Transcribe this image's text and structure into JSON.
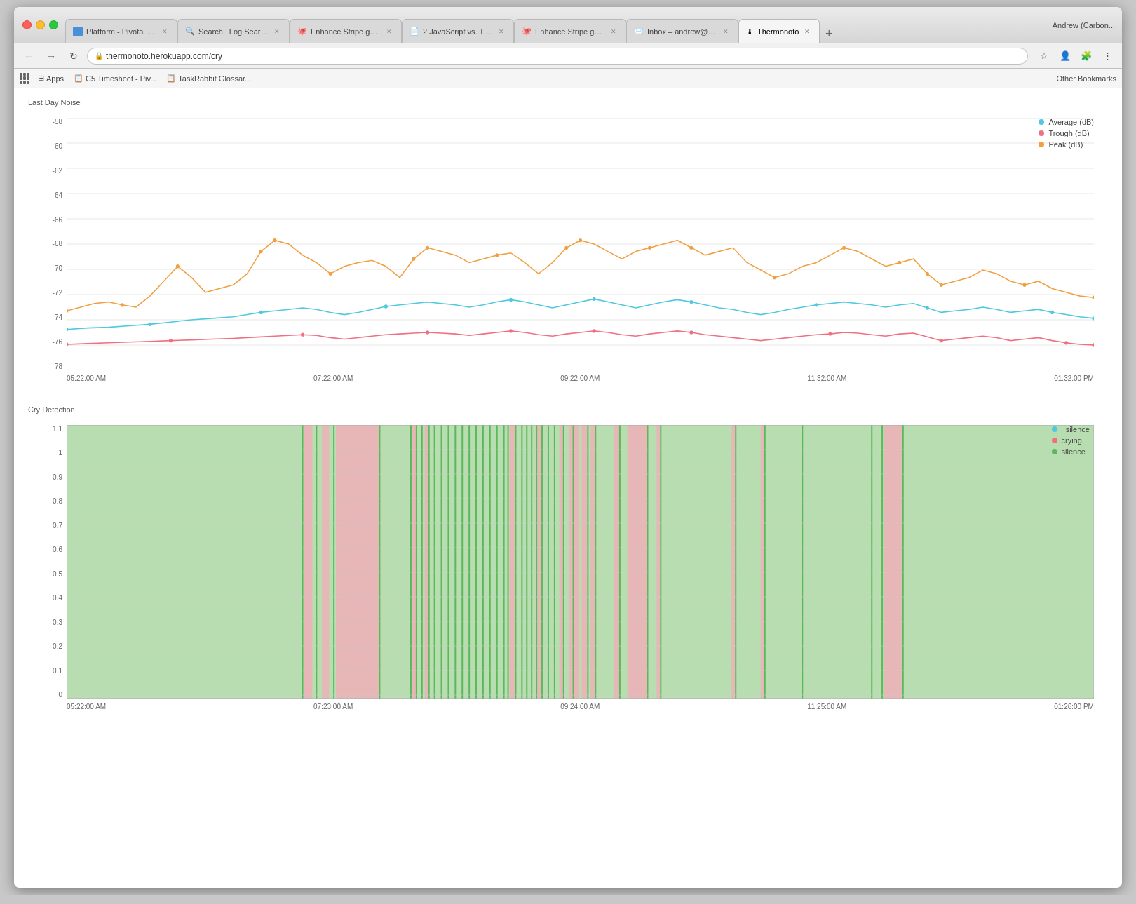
{
  "window": {
    "title": "Thermonoto"
  },
  "browser": {
    "tabs": [
      {
        "id": "tab1",
        "label": "Platform - Pivotal Tra...",
        "icon": "🔵",
        "active": false,
        "favicon": "blue"
      },
      {
        "id": "tab2",
        "label": "Search | Log Search...",
        "icon": "🔍",
        "active": false,
        "favicon": "search"
      },
      {
        "id": "tab3",
        "label": "Enhance Stripe gem...",
        "icon": "🐙",
        "active": false,
        "favicon": "github"
      },
      {
        "id": "tab4",
        "label": "2  JavaScript vs. TypeSc...",
        "icon": "📄",
        "active": false,
        "favicon": "doc"
      },
      {
        "id": "tab5",
        "label": "Enhance Stripe gem t...",
        "icon": "🐙",
        "active": false,
        "favicon": "github"
      },
      {
        "id": "tab6",
        "label": "Inbox – andrew@carb...",
        "icon": "✉️",
        "active": false,
        "favicon": "mail"
      },
      {
        "id": "tab7",
        "label": "Thermonoto",
        "icon": "🌡",
        "active": true,
        "favicon": "thermo"
      }
    ],
    "address": "thermonoto.herokuapp.com/cry",
    "bookmarks": [
      {
        "label": "Apps",
        "icon": "⊞"
      },
      {
        "label": "C5 Timesheet - Piv...",
        "icon": "📋"
      },
      {
        "label": "TaskRabbit Glossar...",
        "icon": "📋"
      }
    ],
    "other_bookmarks": "Other Bookmarks"
  },
  "noise_chart": {
    "title": "Last Day Noise",
    "y_labels": [
      "-58",
      "-60",
      "-62",
      "-64",
      "-66",
      "-68",
      "-70",
      "-72",
      "-74",
      "-76",
      "-78"
    ],
    "x_labels": [
      "05:22:00 AM",
      "07:22:00 AM",
      "09:22:00 AM",
      "11:32:00 AM",
      "01:32:00 PM"
    ],
    "legend": [
      {
        "label": "Average (dB)",
        "color": "#4ec9e0"
      },
      {
        "label": "Trough (dB)",
        "color": "#f07080"
      },
      {
        "label": "Peak (dB)",
        "color": "#f0a040"
      }
    ]
  },
  "cry_chart": {
    "title": "Cry Detection",
    "y_labels": [
      "1.1",
      "1",
      "0.9",
      "0.8",
      "0.7",
      "0.6",
      "0.5",
      "0.4",
      "0.3",
      "0.2",
      "0.1",
      "0"
    ],
    "x_labels": [
      "05:22:00 AM",
      "07:23:00 AM",
      "09:24:00 AM",
      "11:25:00 AM",
      "01:26:00 PM"
    ],
    "legend": [
      {
        "label": "_silence_",
        "color": "#4ec9e0"
      },
      {
        "label": "crying",
        "color": "#f07080"
      },
      {
        "label": "silence",
        "color": "#5cb85c"
      }
    ]
  }
}
